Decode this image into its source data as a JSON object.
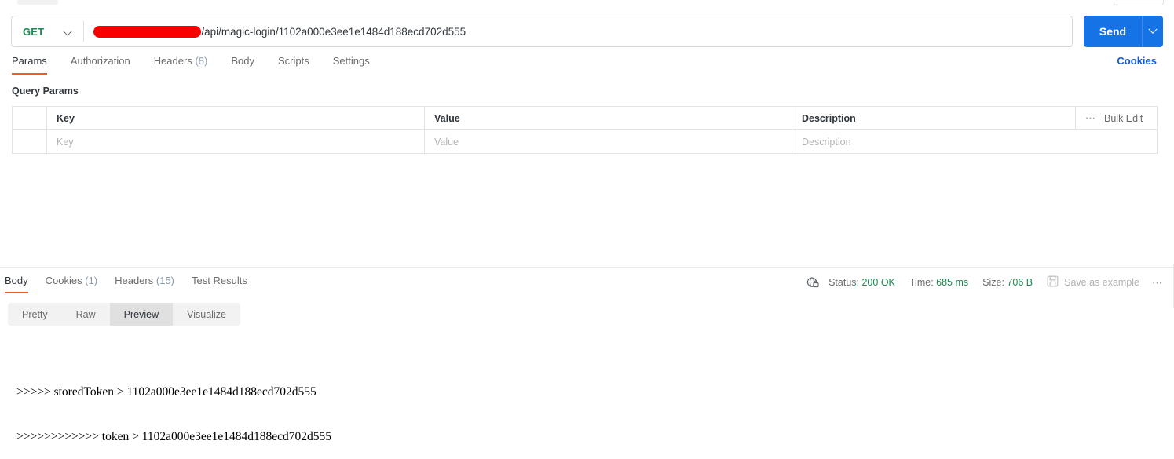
{
  "request": {
    "method": "GET",
    "method_icon": "chevron-down-icon",
    "url_redacted": true,
    "url_text": "/api/magic-login/1102a000e3ee1e1484d188ecd702d555",
    "send_label": "Send",
    "send_caret_icon": "chevron-down-icon",
    "tabs": [
      {
        "label": "Params",
        "count": "",
        "active": true
      },
      {
        "label": "Authorization",
        "count": "",
        "active": false
      },
      {
        "label": "Headers",
        "count": "(8)",
        "active": false
      },
      {
        "label": "Body",
        "count": "",
        "active": false
      },
      {
        "label": "Scripts",
        "count": "",
        "active": false
      },
      {
        "label": "Settings",
        "count": "",
        "active": false
      }
    ],
    "cookies_link": "Cookies"
  },
  "query_params": {
    "title": "Query Params",
    "columns": [
      "Key",
      "Value",
      "Description"
    ],
    "bulk_edit_label": "Bulk Edit",
    "more_icon": "ellipsis-icon",
    "placeholder_row": {
      "key": "Key",
      "value": "Value",
      "description": "Description"
    }
  },
  "response": {
    "tabs": [
      {
        "label": "Body",
        "count": "",
        "active": true
      },
      {
        "label": "Cookies",
        "count": "(1)",
        "active": false
      },
      {
        "label": "Headers",
        "count": "(15)",
        "active": false
      },
      {
        "label": "Test Results",
        "count": "",
        "active": false
      }
    ],
    "meta": {
      "network_icon": "globe-lock-icon",
      "status_label": "Status:",
      "status_value": "200 OK",
      "time_label": "Time:",
      "time_value": "685 ms",
      "size_label": "Size:",
      "size_value": "706 B",
      "save_icon": "save-disk-icon",
      "save_label": "Save as example",
      "more_icon": "ellipsis-icon"
    },
    "view_modes": [
      {
        "label": "Pretty",
        "active": false
      },
      {
        "label": "Raw",
        "active": false
      },
      {
        "label": "Preview",
        "active": true
      },
      {
        "label": "Visualize",
        "active": false
      }
    ],
    "body_preview_line1": ">>>>> storedToken > 1102a000e3ee1e1484d188ecd702d555",
    "body_preview_line2": ">>>>>>>>>>>> token > 1102a000e3ee1e1484d188ecd702d555"
  },
  "colors": {
    "accent_orange": "#ef5b25",
    "send_blue": "#1673e6",
    "link_blue": "#1559d6",
    "status_green": "#1d8a52",
    "redaction_red": "#fa0000"
  }
}
